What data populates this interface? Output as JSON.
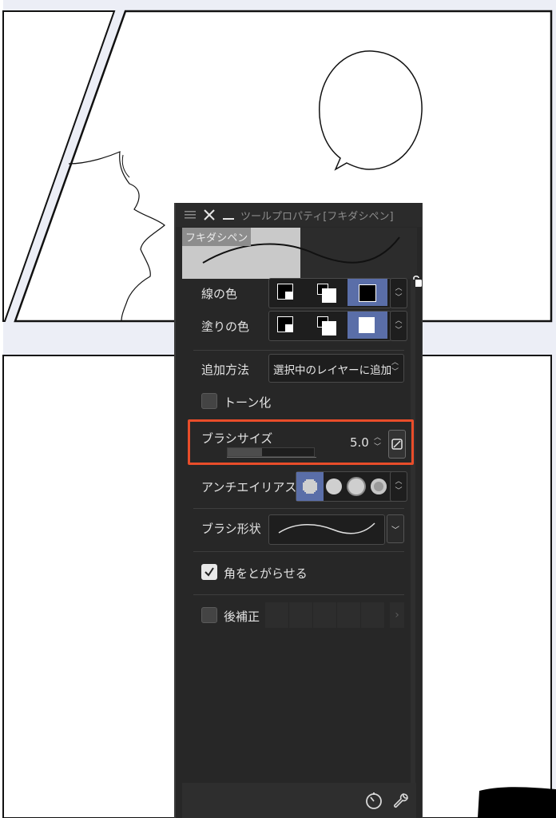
{
  "panel": {
    "title": "ツールプロパティ[フキダシペン]",
    "preview": {
      "name": "フキダシペン"
    },
    "line_color": {
      "label": "線の色"
    },
    "fill_color": {
      "label": "塗りの色"
    },
    "add_method": {
      "label": "追加方法",
      "value": "選択中のレイヤーに追加"
    },
    "tone": {
      "label": "トーン化",
      "checked": false
    },
    "brush_size": {
      "label": "ブラシサイズ",
      "value": "5.0"
    },
    "antialias": {
      "label": "アンチエイリアス"
    },
    "brush_shape": {
      "label": "ブラシ形状"
    },
    "sharp_corners": {
      "label": "角をとがらせる",
      "checked": true
    },
    "post_correction": {
      "label": "後補正",
      "checked": false
    }
  },
  "colors": {
    "highlight": "#e94d2a",
    "accent": "#5a6ea8",
    "panel_bg": "#272727"
  },
  "icons": [
    "menu-icon",
    "close-icon",
    "minimize-icon",
    "lock-icon",
    "chevron-updown-icon",
    "chevron-down-icon",
    "chevron-right-icon",
    "dial-icon",
    "wrench-icon",
    "checkmark-icon"
  ]
}
